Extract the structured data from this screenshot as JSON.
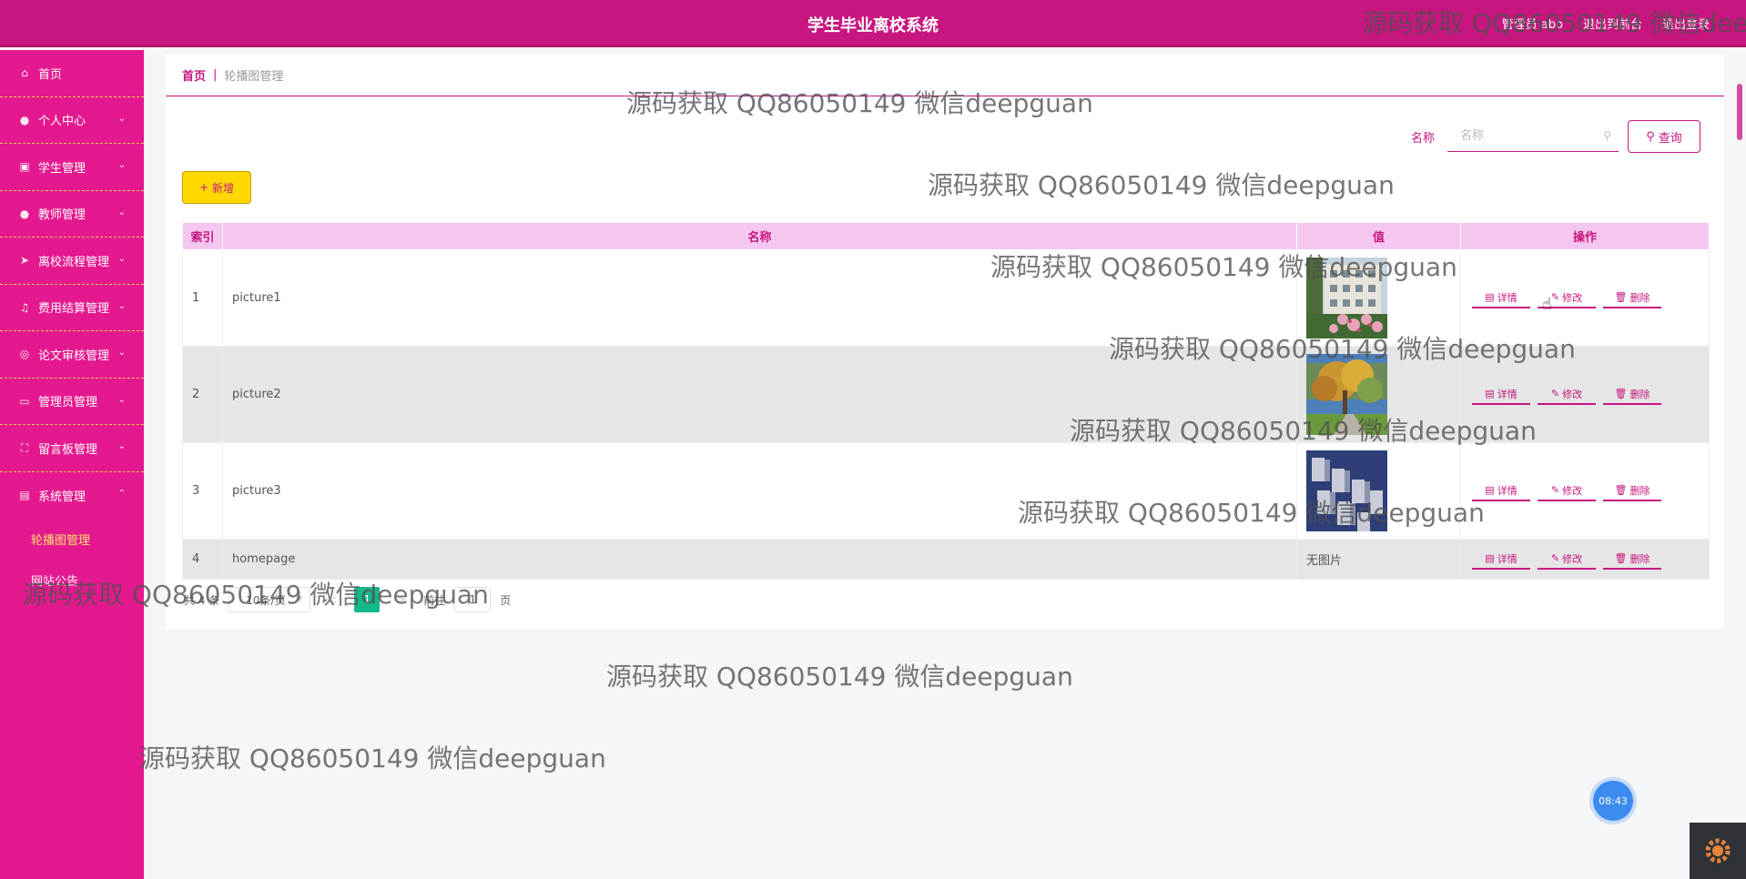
{
  "header": {
    "title": "学生毕业离校系统",
    "user_label": "管理员 abo",
    "front_link": "退出到前台",
    "logout_link": "退出登录"
  },
  "sidebar": {
    "items": [
      {
        "label": "首页",
        "icon": "home-icon"
      },
      {
        "label": "个人中心",
        "icon": "user-icon"
      },
      {
        "label": "学生管理",
        "icon": "student-icon"
      },
      {
        "label": "教师管理",
        "icon": "teacher-icon"
      },
      {
        "label": "离校流程管理",
        "icon": "send-icon"
      },
      {
        "label": "费用结算管理",
        "icon": "bell-icon"
      },
      {
        "label": "论文审核管理",
        "icon": "audit-icon"
      },
      {
        "label": "管理员管理",
        "icon": "chat-icon"
      },
      {
        "label": "留言板管理",
        "icon": "message-icon"
      },
      {
        "label": "系统管理",
        "icon": "system-icon"
      }
    ],
    "sub_items": [
      {
        "label": "轮播图管理",
        "active": true
      },
      {
        "label": "网站公告",
        "active": false
      }
    ]
  },
  "breadcrumb": {
    "home": "首页",
    "separator": "|",
    "current": "轮播图管理"
  },
  "search": {
    "label": "名称",
    "placeholder": "名称",
    "button": "查询"
  },
  "add_button": "新增",
  "table": {
    "headers": [
      "索引",
      "名称",
      "值",
      "操作"
    ],
    "rows": [
      {
        "index": "1",
        "name": "picture1",
        "value": "",
        "image": "building-blossom"
      },
      {
        "index": "2",
        "name": "picture2",
        "value": "",
        "image": "autumn-tree"
      },
      {
        "index": "3",
        "name": "picture3",
        "value": "",
        "image": "blue-architecture"
      },
      {
        "index": "4",
        "name": "homepage",
        "value": "无图片",
        "image": ""
      }
    ],
    "ops": {
      "detail": "详情",
      "edit": "修改",
      "delete": "删除"
    }
  },
  "pagination": {
    "total": "共 4 条",
    "page_size": "10条/页",
    "prev": "<",
    "current": "1",
    "next": ">",
    "goto": "前往",
    "goto_value": "1",
    "page_unit": "页"
  },
  "watermark": "源码获取 QQ86050149 微信deepguan",
  "clock": "08:43",
  "colors": {
    "primary": "#c7167f",
    "sidebar": "#e5198f",
    "accent": "#ffd800",
    "pager_active": "#13b98b"
  }
}
